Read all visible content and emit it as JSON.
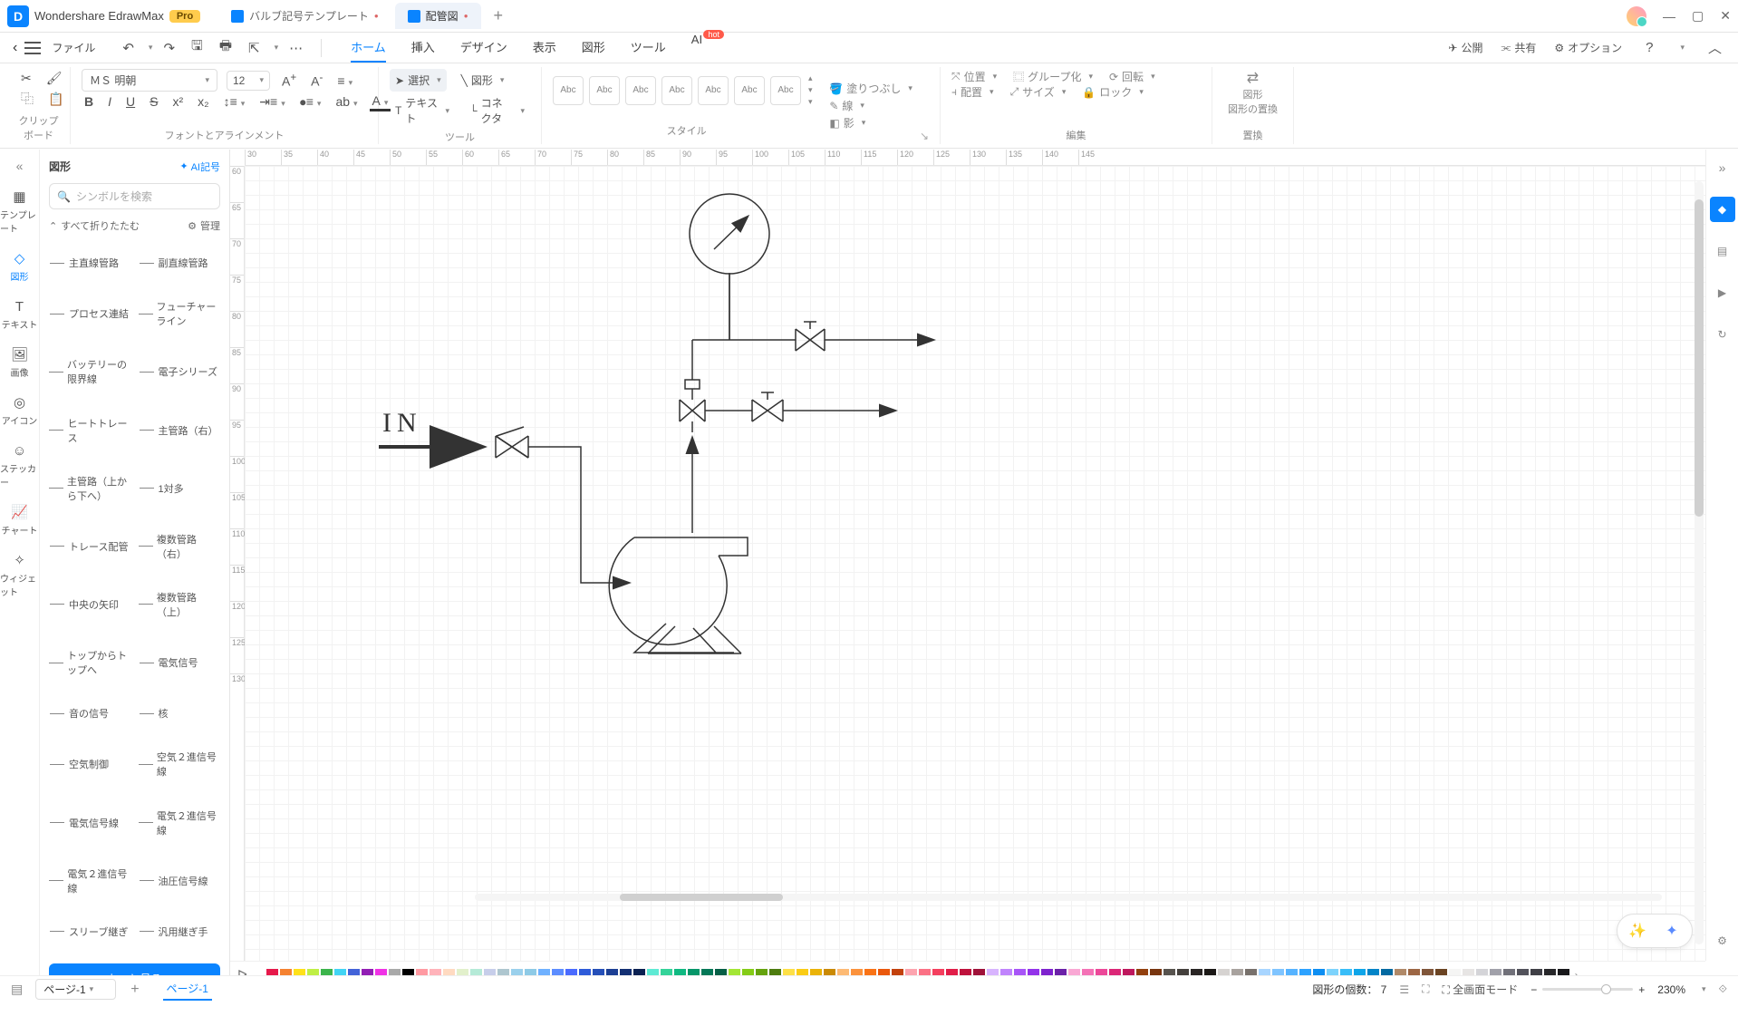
{
  "app": {
    "name": "Wondershare EdrawMax",
    "badge": "Pro"
  },
  "tabs": [
    {
      "label": "バルブ記号テンプレート",
      "dirty": true,
      "active": false
    },
    {
      "label": "配管図",
      "dirty": true,
      "active": true
    }
  ],
  "menubar": {
    "file": "ファイル",
    "tabs": [
      "ホーム",
      "挿入",
      "デザイン",
      "表示",
      "図形",
      "ツール",
      "AI"
    ],
    "activeTab": "ホーム",
    "hot": "hot",
    "right": {
      "publish": "公開",
      "share": "共有",
      "options": "オプション"
    }
  },
  "ribbon": {
    "clipboard": "クリップボード",
    "font": {
      "name": "ＭＳ 明朝",
      "size": "12",
      "group": "フォントとアラインメント"
    },
    "tools": {
      "select": "選択",
      "shape": "図形",
      "text": "テキスト",
      "connector": "コネクタ",
      "group": "ツール"
    },
    "style": {
      "sample": "Abc",
      "group": "スタイル",
      "fill": "塗りつぶし",
      "line": "線",
      "shadow": "影"
    },
    "arrange": {
      "position": "位置",
      "groupBtn": "グループ化",
      "rotate": "回転",
      "align": "配置",
      "size": "サイズ",
      "lock": "ロック",
      "group": "編集"
    },
    "replace": {
      "top": "図形",
      "bottom": "図形の置換",
      "group": "置換"
    }
  },
  "leftRail": [
    {
      "label": "テンプレート"
    },
    {
      "label": "図形",
      "active": true
    },
    {
      "label": "テキスト"
    },
    {
      "label": "画像"
    },
    {
      "label": "アイコン"
    },
    {
      "label": "ステッカー"
    },
    {
      "label": "チャート"
    },
    {
      "label": "ウィジェット"
    }
  ],
  "shapesPanel": {
    "title": "図形",
    "ai": "AI記号",
    "searchPlaceholder": "シンボルを検索",
    "foldAll": "すべて折りたたむ",
    "manage": "管理",
    "items": [
      "主直線管路",
      "副直線管路",
      "プロセス連結",
      "フューチャーライン",
      "バッテリーの限界線",
      "電子シリーズ",
      "ヒートトレース",
      "主管路（右）",
      "主管路（上から下へ）",
      "1対多",
      "トレース配管",
      "複数管路（右）",
      "中央の矢印",
      "複数管路（上）",
      "トップからトップへ",
      "電気信号",
      "音の信号",
      "核",
      "空気制御",
      "空気２進信号線",
      "電気信号線",
      "電気２進信号線",
      "電気２進信号線",
      "油圧信号線",
      "スリーブ継ぎ",
      "汎用継ぎ手"
    ],
    "more": "もっと見る"
  },
  "canvas": {
    "hTicks": [
      "30",
      "35",
      "40",
      "45",
      "50",
      "55",
      "60",
      "65",
      "70",
      "75",
      "80",
      "85",
      "90",
      "95",
      "100",
      "105",
      "110",
      "115",
      "120",
      "125",
      "130",
      "135",
      "140",
      "145"
    ],
    "vTicks": [
      "60",
      "65",
      "70",
      "75",
      "80",
      "85",
      "90",
      "95",
      "100",
      "105",
      "110",
      "115",
      "120",
      "125",
      "130"
    ],
    "inLabel": "IN"
  },
  "colorbar": [
    "#ffffff",
    "#e6194b",
    "#f58231",
    "#ffe119",
    "#bfef45",
    "#3cb44b",
    "#42d4f4",
    "#4363d8",
    "#911eb4",
    "#f032e6",
    "#a9a9a9",
    "#000000",
    "#ff9aa2",
    "#ffb3ba",
    "#ffdac1",
    "#e2f0cb",
    "#b5ead7",
    "#c7ceea",
    "#aec6cf",
    "#9ad0ec",
    "#8ecae6",
    "#6fb1ff",
    "#5c8dff",
    "#4a6bff",
    "#2e5bd9",
    "#254fb8",
    "#1c3f94",
    "#133073",
    "#0b2152",
    "#5eead4",
    "#34d399",
    "#10b981",
    "#059669",
    "#047857",
    "#065f46",
    "#a3e635",
    "#84cc16",
    "#65a30d",
    "#4d7c0f",
    "#fde047",
    "#facc15",
    "#eab308",
    "#ca8a04",
    "#fdba74",
    "#fb923c",
    "#f97316",
    "#ea580c",
    "#c2410c",
    "#fda4af",
    "#fb7185",
    "#f43f5e",
    "#e11d48",
    "#be123c",
    "#9f1239",
    "#d8b4fe",
    "#c084fc",
    "#a855f7",
    "#9333ea",
    "#7e22ce",
    "#6b21a8",
    "#f9a8d4",
    "#f472b6",
    "#ec4899",
    "#db2777",
    "#be185d",
    "#92400e",
    "#78350f",
    "#57534e",
    "#44403c",
    "#292524",
    "#1c1917",
    "#d6d3d1",
    "#a8a29e",
    "#78716c",
    "#a8d5ff",
    "#7fc4ff",
    "#56b3ff",
    "#2da2ff",
    "#0d8ef2",
    "#7dd3fc",
    "#38bdf8",
    "#0ea5e9",
    "#0284c7",
    "#0369a1",
    "#b08968",
    "#9c6644",
    "#7f5539",
    "#6b4423",
    "#f5f5f4",
    "#e7e5e4",
    "#d4d4d8",
    "#a1a1aa",
    "#71717a",
    "#52525b",
    "#3f3f46",
    "#27272a",
    "#18181b"
  ],
  "statusbar": {
    "pageDropdown": "ページ-1",
    "pageTab": "ページ-1",
    "shapeCount": "図形の個数： 7",
    "fullscreen": "全画面モード",
    "zoom": "230%"
  }
}
